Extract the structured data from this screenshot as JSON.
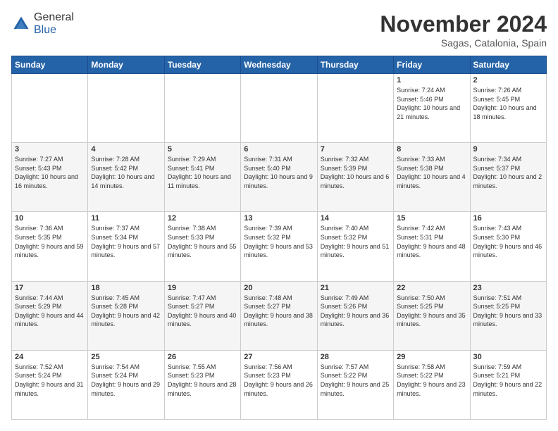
{
  "logo": {
    "general": "General",
    "blue": "Blue"
  },
  "header": {
    "month": "November 2024",
    "location": "Sagas, Catalonia, Spain"
  },
  "weekdays": [
    "Sunday",
    "Monday",
    "Tuesday",
    "Wednesday",
    "Thursday",
    "Friday",
    "Saturday"
  ],
  "weeks": [
    [
      {
        "day": "",
        "info": ""
      },
      {
        "day": "",
        "info": ""
      },
      {
        "day": "",
        "info": ""
      },
      {
        "day": "",
        "info": ""
      },
      {
        "day": "",
        "info": ""
      },
      {
        "day": "1",
        "info": "Sunrise: 7:24 AM\nSunset: 5:46 PM\nDaylight: 10 hours and 21 minutes."
      },
      {
        "day": "2",
        "info": "Sunrise: 7:26 AM\nSunset: 5:45 PM\nDaylight: 10 hours and 18 minutes."
      }
    ],
    [
      {
        "day": "3",
        "info": "Sunrise: 7:27 AM\nSunset: 5:43 PM\nDaylight: 10 hours and 16 minutes."
      },
      {
        "day": "4",
        "info": "Sunrise: 7:28 AM\nSunset: 5:42 PM\nDaylight: 10 hours and 14 minutes."
      },
      {
        "day": "5",
        "info": "Sunrise: 7:29 AM\nSunset: 5:41 PM\nDaylight: 10 hours and 11 minutes."
      },
      {
        "day": "6",
        "info": "Sunrise: 7:31 AM\nSunset: 5:40 PM\nDaylight: 10 hours and 9 minutes."
      },
      {
        "day": "7",
        "info": "Sunrise: 7:32 AM\nSunset: 5:39 PM\nDaylight: 10 hours and 6 minutes."
      },
      {
        "day": "8",
        "info": "Sunrise: 7:33 AM\nSunset: 5:38 PM\nDaylight: 10 hours and 4 minutes."
      },
      {
        "day": "9",
        "info": "Sunrise: 7:34 AM\nSunset: 5:37 PM\nDaylight: 10 hours and 2 minutes."
      }
    ],
    [
      {
        "day": "10",
        "info": "Sunrise: 7:36 AM\nSunset: 5:35 PM\nDaylight: 9 hours and 59 minutes."
      },
      {
        "day": "11",
        "info": "Sunrise: 7:37 AM\nSunset: 5:34 PM\nDaylight: 9 hours and 57 minutes."
      },
      {
        "day": "12",
        "info": "Sunrise: 7:38 AM\nSunset: 5:33 PM\nDaylight: 9 hours and 55 minutes."
      },
      {
        "day": "13",
        "info": "Sunrise: 7:39 AM\nSunset: 5:32 PM\nDaylight: 9 hours and 53 minutes."
      },
      {
        "day": "14",
        "info": "Sunrise: 7:40 AM\nSunset: 5:32 PM\nDaylight: 9 hours and 51 minutes."
      },
      {
        "day": "15",
        "info": "Sunrise: 7:42 AM\nSunset: 5:31 PM\nDaylight: 9 hours and 48 minutes."
      },
      {
        "day": "16",
        "info": "Sunrise: 7:43 AM\nSunset: 5:30 PM\nDaylight: 9 hours and 46 minutes."
      }
    ],
    [
      {
        "day": "17",
        "info": "Sunrise: 7:44 AM\nSunset: 5:29 PM\nDaylight: 9 hours and 44 minutes."
      },
      {
        "day": "18",
        "info": "Sunrise: 7:45 AM\nSunset: 5:28 PM\nDaylight: 9 hours and 42 minutes."
      },
      {
        "day": "19",
        "info": "Sunrise: 7:47 AM\nSunset: 5:27 PM\nDaylight: 9 hours and 40 minutes."
      },
      {
        "day": "20",
        "info": "Sunrise: 7:48 AM\nSunset: 5:27 PM\nDaylight: 9 hours and 38 minutes."
      },
      {
        "day": "21",
        "info": "Sunrise: 7:49 AM\nSunset: 5:26 PM\nDaylight: 9 hours and 36 minutes."
      },
      {
        "day": "22",
        "info": "Sunrise: 7:50 AM\nSunset: 5:25 PM\nDaylight: 9 hours and 35 minutes."
      },
      {
        "day": "23",
        "info": "Sunrise: 7:51 AM\nSunset: 5:25 PM\nDaylight: 9 hours and 33 minutes."
      }
    ],
    [
      {
        "day": "24",
        "info": "Sunrise: 7:52 AM\nSunset: 5:24 PM\nDaylight: 9 hours and 31 minutes."
      },
      {
        "day": "25",
        "info": "Sunrise: 7:54 AM\nSunset: 5:24 PM\nDaylight: 9 hours and 29 minutes."
      },
      {
        "day": "26",
        "info": "Sunrise: 7:55 AM\nSunset: 5:23 PM\nDaylight: 9 hours and 28 minutes."
      },
      {
        "day": "27",
        "info": "Sunrise: 7:56 AM\nSunset: 5:23 PM\nDaylight: 9 hours and 26 minutes."
      },
      {
        "day": "28",
        "info": "Sunrise: 7:57 AM\nSunset: 5:22 PM\nDaylight: 9 hours and 25 minutes."
      },
      {
        "day": "29",
        "info": "Sunrise: 7:58 AM\nSunset: 5:22 PM\nDaylight: 9 hours and 23 minutes."
      },
      {
        "day": "30",
        "info": "Sunrise: 7:59 AM\nSunset: 5:21 PM\nDaylight: 9 hours and 22 minutes."
      }
    ]
  ]
}
